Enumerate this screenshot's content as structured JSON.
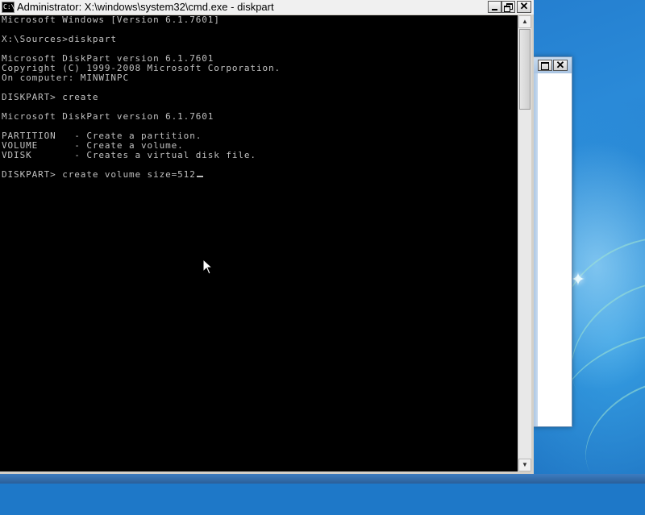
{
  "window": {
    "title": "Administrator: X:\\windows\\system32\\cmd.exe - diskpart",
    "icon": "cmd-icon",
    "icon_text": "C:\\"
  },
  "titlebar_buttons": {
    "minimize": "minimize-icon",
    "maximize": "restore-icon",
    "close_label": "✕"
  },
  "background_window": {
    "close_label": "✕"
  },
  "console": {
    "lines": [
      "Microsoft Windows [Version 6.1.7601]",
      "",
      "X:\\Sources>diskpart",
      "",
      "Microsoft DiskPart version 6.1.7601",
      "Copyright (C) 1999-2008 Microsoft Corporation.",
      "On computer: MINWINPC",
      "",
      "DISKPART> create",
      "",
      "Microsoft DiskPart version 6.1.7601",
      "",
      "PARTITION   - Create a partition.",
      "VOLUME      - Create a volume.",
      "VDISK       - Creates a virtual disk file.",
      "",
      "DISKPART> create volume size=512"
    ],
    "text_color": "#c0c0c0",
    "background": "#000000"
  },
  "scrollbar": {
    "up_icon": "scroll-up-arrow-icon",
    "down_icon": "scroll-down-arrow-icon",
    "up_glyph": "▲",
    "down_glyph": "▼"
  },
  "colors": {
    "desktop": "#1e78c8",
    "console_bg": "#000000",
    "console_fg": "#c0c0c0"
  }
}
